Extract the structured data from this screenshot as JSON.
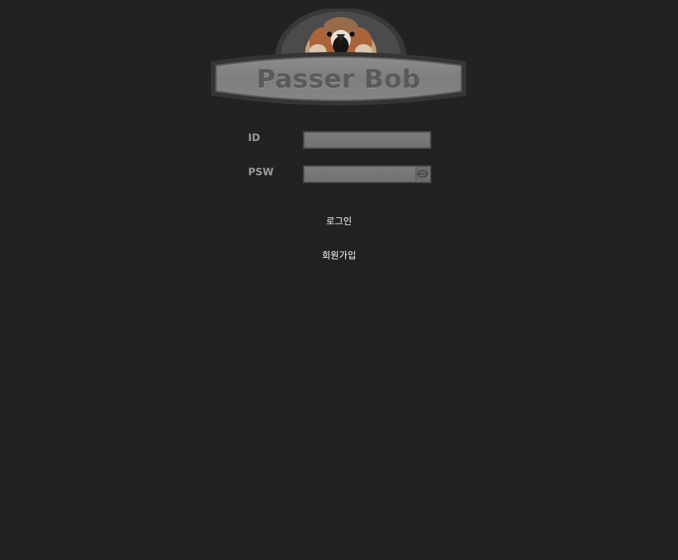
{
  "logo": {
    "title": "Passer Bob",
    "image": "sparrow-image"
  },
  "form": {
    "id_label": "ID",
    "id_value": "",
    "psw_label": "PSW",
    "psw_value": "",
    "reveal_icon": "eye-icon"
  },
  "actions": {
    "login_label": "로그인",
    "signup_label": "회원가입"
  },
  "colors": {
    "background": "#222222",
    "input_fill": "#777777",
    "label": "#9a9a9a",
    "link": "#ffffff"
  }
}
